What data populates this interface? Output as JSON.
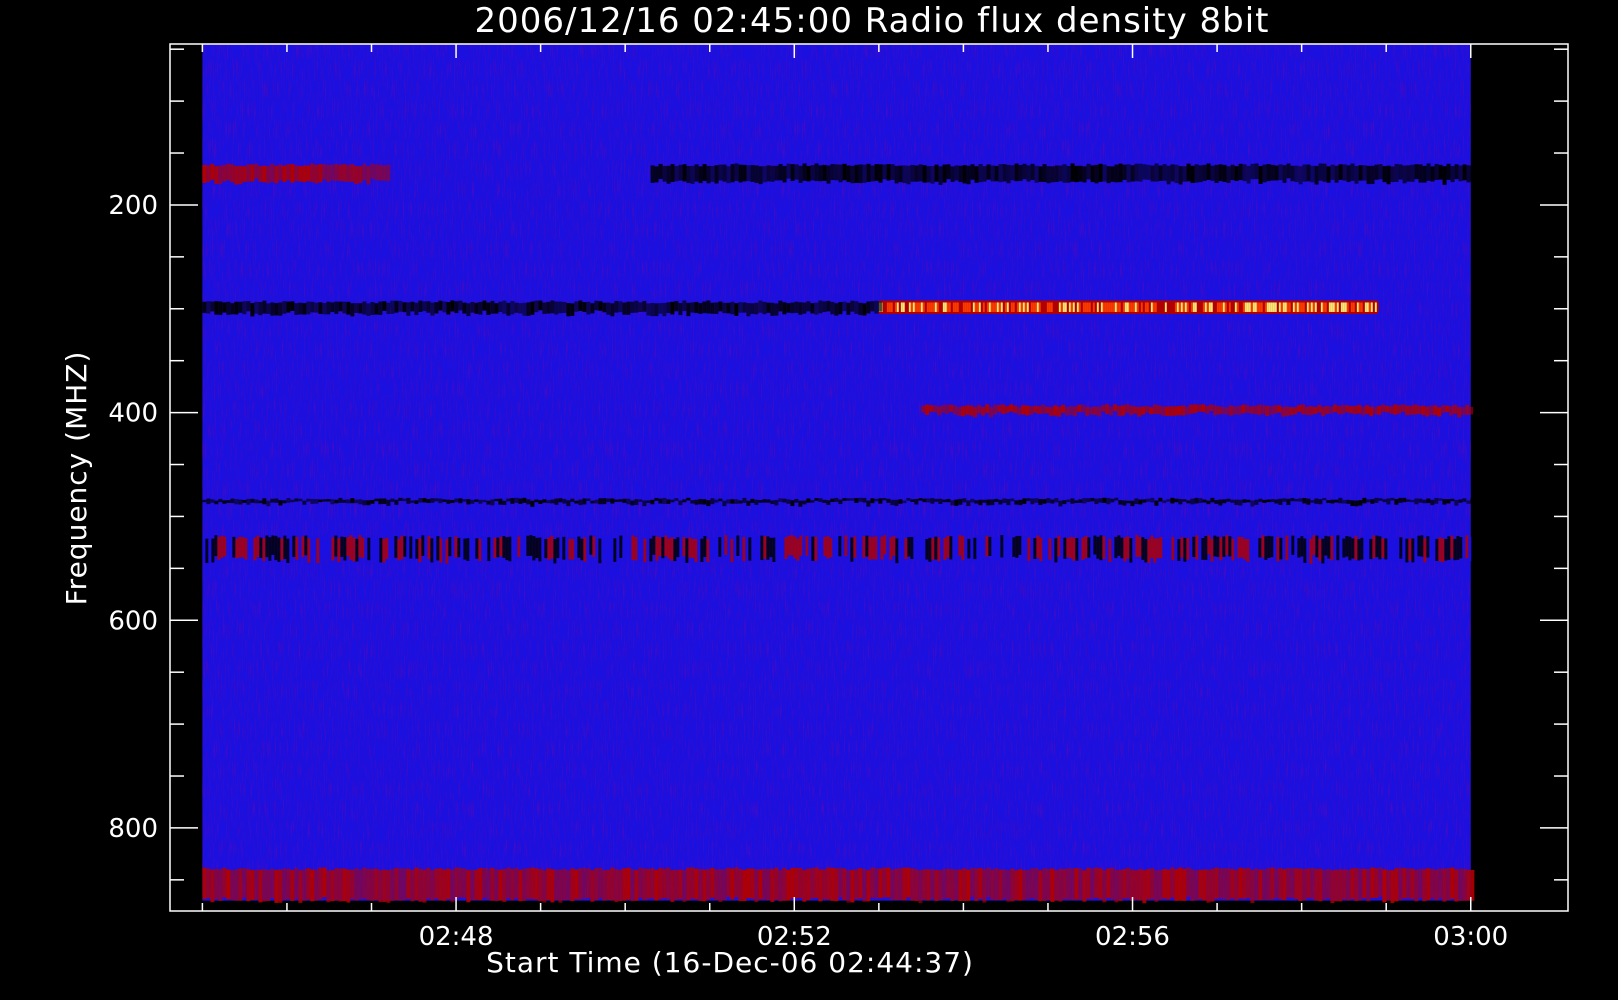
{
  "chart_data": {
    "type": "heatmap",
    "title": "2006/12/16 02:45:00 Radio flux density 8bit",
    "xlabel": "Start Time (16-Dec-06 02:44:37)",
    "ylabel": "Frequency (MHZ)",
    "x_ticks": [
      "02:48",
      "02:52",
      "02:56",
      "03:00"
    ],
    "x_tick_minutes": [
      48,
      52,
      56,
      60
    ],
    "x_range_minutes": [
      44.617,
      61.15
    ],
    "data_x_range_minutes": [
      45.0,
      60.0
    ],
    "y_ticks": [
      200,
      400,
      600,
      800
    ],
    "y_range": [
      45,
      880
    ],
    "data_y_range": [
      45,
      870
    ],
    "y_inverted": true,
    "colormap": {
      "background": "#1a10e0",
      "low": "#000000",
      "mid": "#b00000",
      "high": "#ff4000",
      "peak": "#ffff80"
    },
    "features": [
      {
        "kind": "band",
        "name": "black band",
        "freq": [
          160,
          178
        ],
        "t": [
          50.3,
          60.0
        ],
        "level": "low"
      },
      {
        "kind": "band",
        "name": "red band",
        "freq": [
          160,
          178
        ],
        "t": [
          45.0,
          47.2
        ],
        "level": "mid"
      },
      {
        "kind": "band",
        "name": "burst band",
        "freq": [
          292,
          305
        ],
        "t": [
          53.0,
          58.9
        ],
        "level": "high"
      },
      {
        "kind": "band",
        "name": "dark band",
        "freq": [
          292,
          305
        ],
        "t": [
          45.0,
          53.0
        ],
        "level": "low"
      },
      {
        "kind": "band",
        "name": "red band",
        "freq": [
          392,
          402
        ],
        "t": [
          53.5,
          60.0
        ],
        "level": "mid"
      },
      {
        "kind": "band",
        "name": "mixed band",
        "freq": [
          518,
          542
        ],
        "t": [
          45.0,
          60.0
        ],
        "level": "mixed"
      },
      {
        "kind": "band",
        "name": "dark line",
        "freq": [
          482,
          488
        ],
        "t": [
          45.0,
          60.0
        ],
        "level": "low"
      },
      {
        "kind": "band",
        "name": "red band",
        "freq": [
          838,
          870
        ],
        "t": [
          45.0,
          60.0
        ],
        "level": "mid"
      }
    ]
  }
}
